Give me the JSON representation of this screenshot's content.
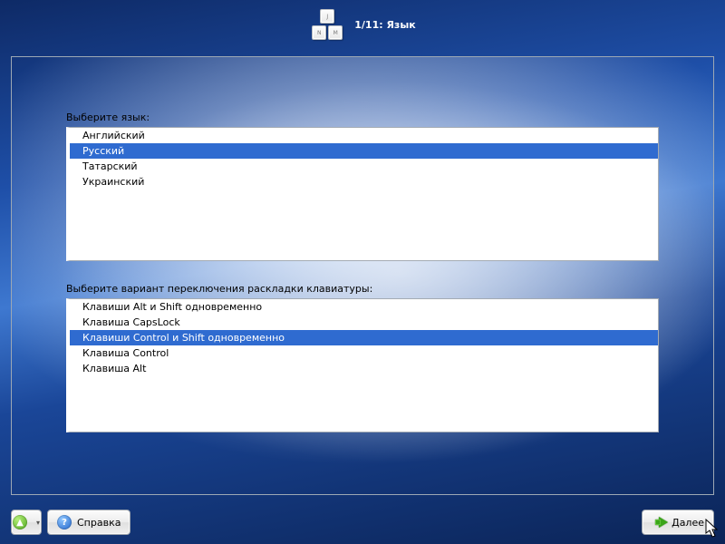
{
  "header": {
    "step_title": "1/11: Язык",
    "keys": [
      "J",
      "N",
      "M"
    ]
  },
  "language": {
    "label": "Выберите язык:",
    "items": [
      "Английский",
      "Русский",
      "Татарский",
      "Украинский"
    ],
    "selected_index": 1
  },
  "layout_switch": {
    "label": "Выберите вариант переключения раскладки клавиатуры:",
    "items": [
      "Клавиши Alt и Shift одновременно",
      "Клавиша CapsLock",
      "Клавиши Control и Shift одновременно",
      "Клавиша Control",
      "Клавиша Alt"
    ],
    "selected_index": 2
  },
  "footer": {
    "help_label": "Справка",
    "next_label": "Далее"
  }
}
